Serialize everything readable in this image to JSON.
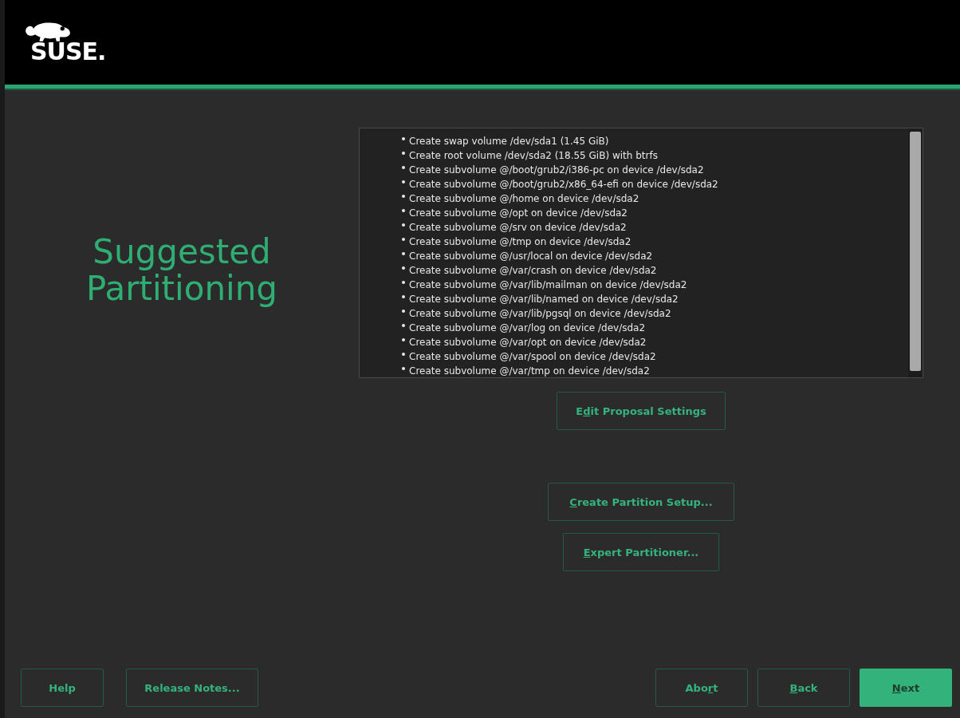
{
  "header": {
    "logo_text": "SUSE."
  },
  "title": "Suggested Partitioning",
  "proposal": {
    "items": [
      "Create swap volume /dev/sda1 (1.45 GiB)",
      "Create root volume /dev/sda2 (18.55 GiB) with btrfs",
      "Create subvolume @/boot/grub2/i386-pc on device /dev/sda2",
      "Create subvolume @/boot/grub2/x86_64-efi on device /dev/sda2",
      "Create subvolume @/home on device /dev/sda2",
      "Create subvolume @/opt on device /dev/sda2",
      "Create subvolume @/srv on device /dev/sda2",
      "Create subvolume @/tmp on device /dev/sda2",
      "Create subvolume @/usr/local on device /dev/sda2",
      "Create subvolume @/var/crash on device /dev/sda2",
      "Create subvolume @/var/lib/mailman on device /dev/sda2",
      "Create subvolume @/var/lib/named on device /dev/sda2",
      "Create subvolume @/var/lib/pgsql on device /dev/sda2",
      "Create subvolume @/var/log on device /dev/sda2",
      "Create subvolume @/var/opt on device /dev/sda2",
      "Create subvolume @/var/spool on device /dev/sda2",
      "Create subvolume @/var/tmp on device /dev/sda2"
    ]
  },
  "actions": [
    {
      "pre": "E",
      "key": "d",
      "post": "it Proposal Settings"
    },
    {
      "key": "C",
      "post": "reate Partition Setup..."
    },
    {
      "key": "E",
      "post": "xpert Partitioner..."
    }
  ],
  "footer": {
    "left": [
      {
        "pre": "Help",
        "primary": false
      },
      {
        "pre": "Release Notes...",
        "primary": false
      }
    ],
    "right": [
      {
        "pre": "Abo",
        "key": "r",
        "post": "t",
        "primary": false
      },
      {
        "key": "B",
        "post": "ack",
        "primary": false
      },
      {
        "key": "N",
        "post": "ext",
        "primary": true
      }
    ]
  }
}
